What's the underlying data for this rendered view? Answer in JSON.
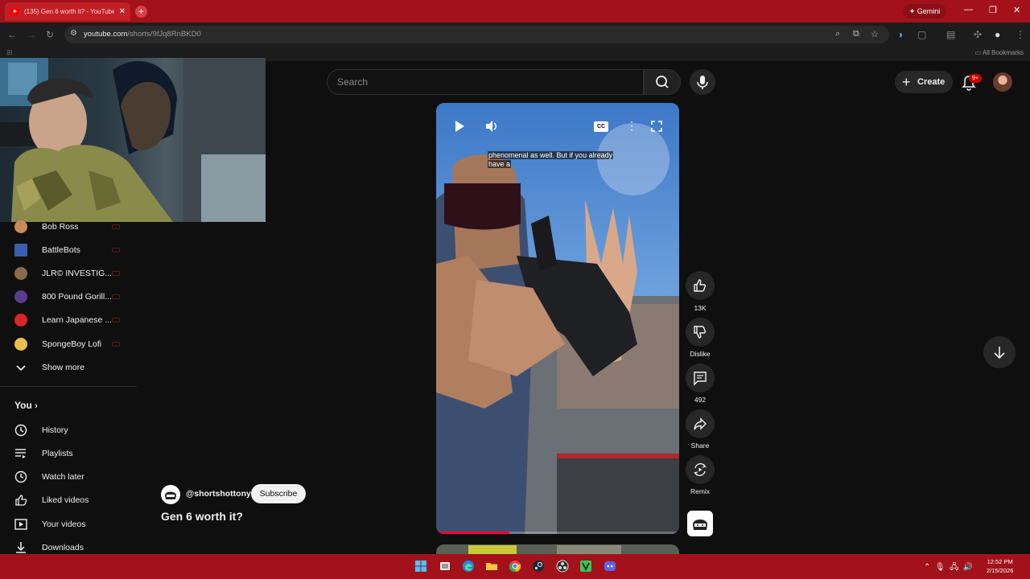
{
  "browser": {
    "tab_title": "(135) Gen 6 worth it? - YouTube",
    "new_tab": "+",
    "gemini_label": "Gemini",
    "url_host": "youtube.com",
    "url_path": "/shorts/9fJq8RnBKD0",
    "all_bookmarks": "All Bookmarks"
  },
  "masthead": {
    "search_placeholder": "Search",
    "create_label": "Create",
    "notification_badge": "9+"
  },
  "sidebar": {
    "subscriptions": [
      {
        "label": "Bob Ross",
        "color": "#c98a5a"
      },
      {
        "label": "BattleBots",
        "color": "#3a5fb0"
      },
      {
        "label": "JLR© INVESTIG...",
        "color": "#8a6a4a"
      },
      {
        "label": "800 Pound Gorill...",
        "color": "#5a3a8a"
      },
      {
        "label": "Learn Japanese ...",
        "color": "#d9262b"
      },
      {
        "label": "SpongeBoy Lofi",
        "color": "#e8c04a"
      }
    ],
    "show_more": "Show more",
    "you_heading": "You",
    "you_items": [
      {
        "label": "History",
        "icon": "history-icon"
      },
      {
        "label": "Playlists",
        "icon": "playlists-icon"
      },
      {
        "label": "Watch later",
        "icon": "watch-later-icon"
      },
      {
        "label": "Liked videos",
        "icon": "like-icon"
      },
      {
        "label": "Your videos",
        "icon": "your-videos-icon"
      },
      {
        "label": "Downloads",
        "icon": "download-icon"
      }
    ]
  },
  "short": {
    "channel": "@shortshottony",
    "subscribe": "Subscribe",
    "title": "Gen 6 worth it?",
    "caption_line1": "phenomenal as well. But if you already",
    "caption_line2": "have a",
    "cc_label": "CC",
    "progress": 0.3
  },
  "actions": {
    "likes": "13K",
    "dislike": "Dislike",
    "comments": "492",
    "share": "Share",
    "remix": "Remix"
  },
  "taskbar": {
    "time": "12:52 PM",
    "date": "2/15/2026"
  },
  "colors": {
    "chrome_accent": "#a3121a",
    "youtube_red": "#ff0033"
  }
}
